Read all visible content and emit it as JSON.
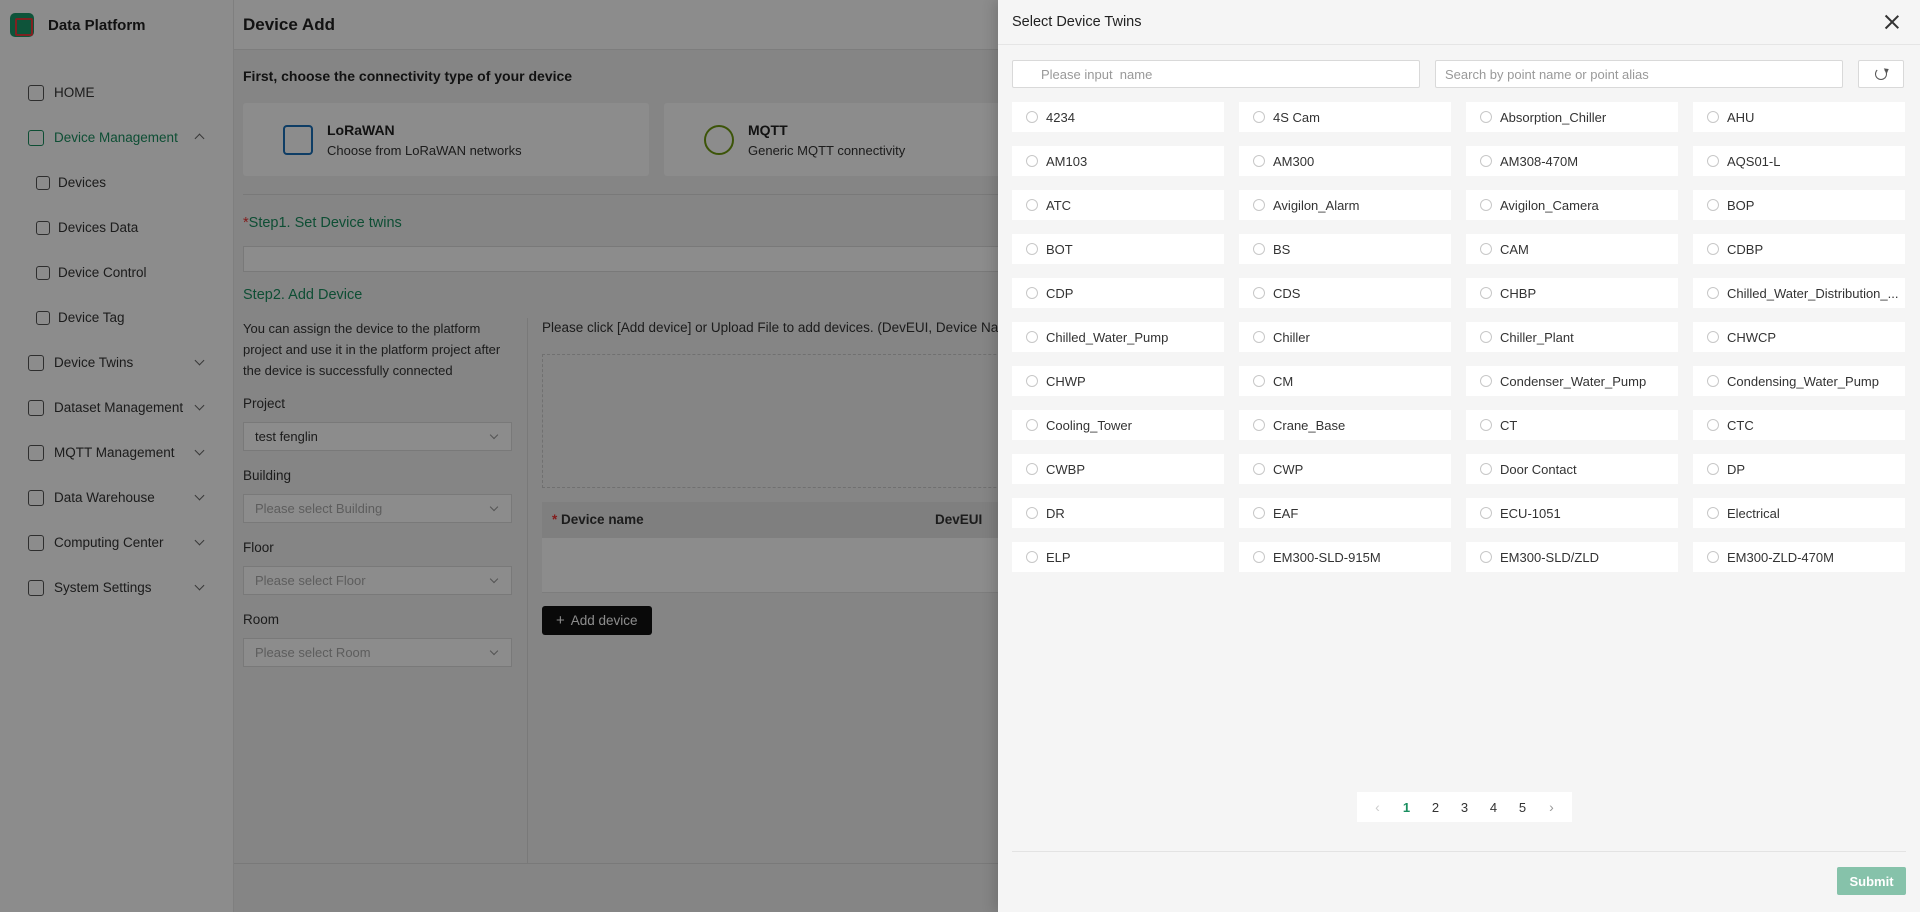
{
  "sidebar": {
    "brand": "Data Platform",
    "items": [
      {
        "label": "HOME"
      },
      {
        "label": "Device Management"
      },
      {
        "label": "Devices"
      },
      {
        "label": "Devices Data"
      },
      {
        "label": "Device Control"
      },
      {
        "label": "Device Tag"
      },
      {
        "label": "Device Twins"
      },
      {
        "label": "Dataset Management"
      },
      {
        "label": "MQTT Management"
      },
      {
        "label": "Data Warehouse"
      },
      {
        "label": "Computing Center"
      },
      {
        "label": "System Settings"
      }
    ]
  },
  "main": {
    "title": "Device Add",
    "section_title": "First, choose the connectivity type of your device",
    "connectivity": [
      {
        "name": "LoRaWAN",
        "desc": "Choose from LoRaWAN networks"
      },
      {
        "name": "MQTT",
        "desc": "Generic MQTT connectivity"
      }
    ],
    "step1_req": "*",
    "step1": "Step1. Set Device twins",
    "step2": "Step2. Add Device",
    "assign_text": "You can assign the device to the platform project and use it in the platform project after the device is successfully connected",
    "project_label": "Project",
    "project_value": "test fenglin",
    "building_label": "Building",
    "building_placeholder": "Please select Building",
    "floor_label": "Floor",
    "floor_placeholder": "Please select Floor",
    "room_label": "Room",
    "room_placeholder": "Please select Room",
    "click_text": "Please click [Add device] or Upload File to add devices. (DevEUI, Device Name B",
    "col_req": "*",
    "col_device_name": "Device name",
    "col_deveui": "DevEUI",
    "add_device_label": "Add device",
    "add_icon": "+"
  },
  "drawer": {
    "title": "Select Device Twins",
    "search_placeholder": "Please input  name",
    "point_placeholder": "Search by point name or point alias",
    "options": [
      "4234",
      "4S Cam",
      "Absorption_Chiller",
      "AHU",
      "AM103",
      "AM300",
      "AM308-470M",
      "AQS01-L",
      "ATC",
      "Avigilon_Alarm",
      "Avigilon_Camera",
      "BOP",
      "BOT",
      "BS",
      "CAM",
      "CDBP",
      "CDP",
      "CDS",
      "CHBP",
      "Chilled_Water_Distribution_...",
      "Chilled_Water_Pump",
      "Chiller",
      "Chiller_Plant",
      "CHWCP",
      "CHWP",
      "CM",
      "Condenser_Water_Pump",
      "Condensing_Water_Pump",
      "Cooling_Tower",
      "Crane_Base",
      "CT",
      "CTC",
      "CWBP",
      "CWP",
      "Door Contact",
      "DP",
      "DR",
      "EAF",
      "ECU-1051",
      "Electrical",
      "ELP",
      "EM300-SLD-915M",
      "EM300-SLD/ZLD",
      "EM300-ZLD-470M"
    ],
    "pagination": {
      "prev": "‹",
      "pages": [
        "1",
        "2",
        "3",
        "4",
        "5"
      ],
      "current": "1",
      "next": "›"
    },
    "submit_label": "Submit"
  },
  "colors": {
    "accent": "#1a8f60",
    "submit": "#86c2aa",
    "overlay": "rgba(0,0,0,0.45)"
  }
}
